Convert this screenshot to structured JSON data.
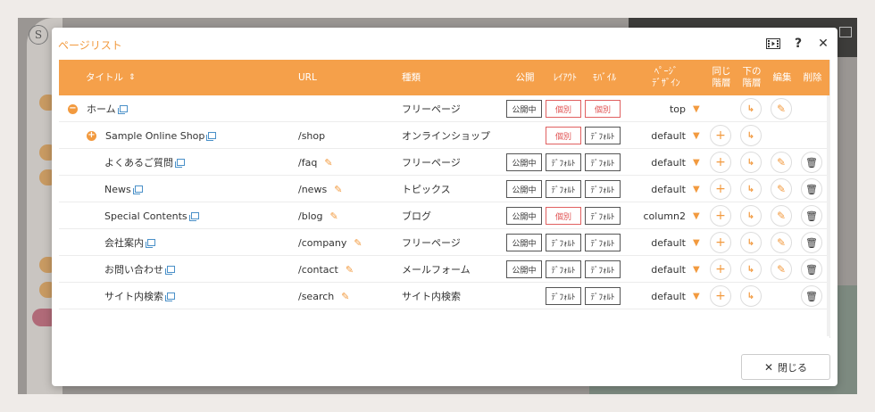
{
  "modal": {
    "title": "ページリスト",
    "close_label": "閉じる"
  },
  "columns": {
    "title": "タイトル",
    "url": "URL",
    "type": "種類",
    "public": "公開",
    "layout": "ﾚｲｱｳﾄ",
    "mobile": "ﾓﾊﾞｲﾙ",
    "design_line1": "ﾍﾟｰｼﾞ",
    "design_line2": "ﾃﾞｻﾞｲﾝ",
    "same_line1": "同じ",
    "same_line2": "階層",
    "under_line1": "下の",
    "under_line2": "階層",
    "edit": "編集",
    "delete": "削除"
  },
  "rows": [
    {
      "title": "ホーム",
      "url": "",
      "type": "フリーページ",
      "public": "公開中",
      "layout": "個別",
      "mobile": "個別",
      "design": "top"
    },
    {
      "title": "Sample Online Shop",
      "url": "/shop",
      "type": "オンラインショップ",
      "public": "",
      "layout": "個別",
      "mobile": "ﾃﾞﾌｫﾙﾄ",
      "design": "default"
    },
    {
      "title": "よくあるご質問",
      "url": "/faq",
      "type": "フリーページ",
      "public": "公開中",
      "layout": "ﾃﾞﾌｫﾙﾄ",
      "mobile": "ﾃﾞﾌｫﾙﾄ",
      "design": "default"
    },
    {
      "title": "News",
      "url": "/news",
      "type": "トピックス",
      "public": "公開中",
      "layout": "ﾃﾞﾌｫﾙﾄ",
      "mobile": "ﾃﾞﾌｫﾙﾄ",
      "design": "default"
    },
    {
      "title": "Special Contents",
      "url": "/blog",
      "type": "ブログ",
      "public": "公開中",
      "layout": "個別",
      "mobile": "ﾃﾞﾌｫﾙﾄ",
      "design": "column2"
    },
    {
      "title": "会社案内",
      "url": "/company",
      "type": "フリーページ",
      "public": "公開中",
      "layout": "ﾃﾞﾌｫﾙﾄ",
      "mobile": "ﾃﾞﾌｫﾙﾄ",
      "design": "default"
    },
    {
      "title": "お問い合わせ",
      "url": "/contact",
      "type": "メールフォーム",
      "public": "公開中",
      "layout": "ﾃﾞﾌｫﾙﾄ",
      "mobile": "ﾃﾞﾌｫﾙﾄ",
      "design": "default"
    },
    {
      "title": "サイト内検索",
      "url": "/search",
      "type": "サイト内検索",
      "public": "",
      "layout": "ﾃﾞﾌｫﾙﾄ",
      "mobile": "ﾃﾞﾌｫﾙﾄ",
      "design": "default"
    }
  ],
  "icons": {
    "slideshow": "film-icon",
    "help": "question-icon",
    "close": "close-icon"
  },
  "colors": {
    "accent": "#f5a04a",
    "accent_text": "#f29a3f",
    "alert_red": "#e05050"
  }
}
